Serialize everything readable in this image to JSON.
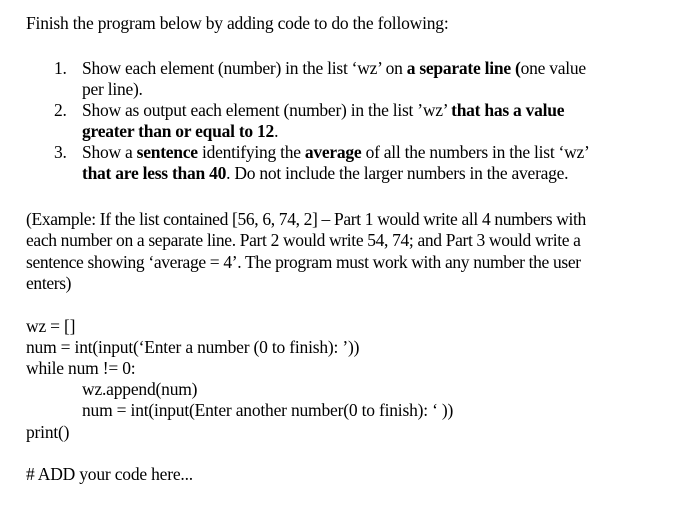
{
  "document": {
    "intro": "Finish the program below by adding code to do the following:",
    "tasks": [
      {
        "number": "1.",
        "line1_pre": "Show each element (number) in the list ‘wz’ on ",
        "line1_bold": "a separate line (",
        "line1_post": "one value",
        "line2": "per line)."
      },
      {
        "number": "2.",
        "line1_pre": "Show as output each element (number) in the list ’wz’ ",
        "line1_bold": "that has a value",
        "line2_bold": "greater than or equal to 12",
        "line2_post": "."
      },
      {
        "number": "3.",
        "line1_a": "Show a ",
        "line1_bold1": "sentence",
        "line1_b": " identifying the ",
        "line1_bold2": "average",
        "line1_c": " of all the numbers in the list ‘wz’",
        "line2_bold": "that are less than 40",
        "line2_post": ". Do not include the larger numbers in the average."
      }
    ],
    "example": [
      "(Example: If the list contained [56, 6, 74, 2] – Part 1 would write all 4 numbers with",
      "each number on a separate line. Part 2 would write 54, 74; and Part 3 would write a",
      "sentence showing ‘average = 4’. The program must work with any number the user",
      "enters)"
    ],
    "code": [
      "wz = []",
      "num = int(input(‘Enter a number (0 to finish): ’))",
      "while num != 0:",
      "wz.append(num)",
      "num = int(input(Enter another number(0 to finish): ‘ ))",
      "print()",
      "# ADD your code here..."
    ]
  }
}
